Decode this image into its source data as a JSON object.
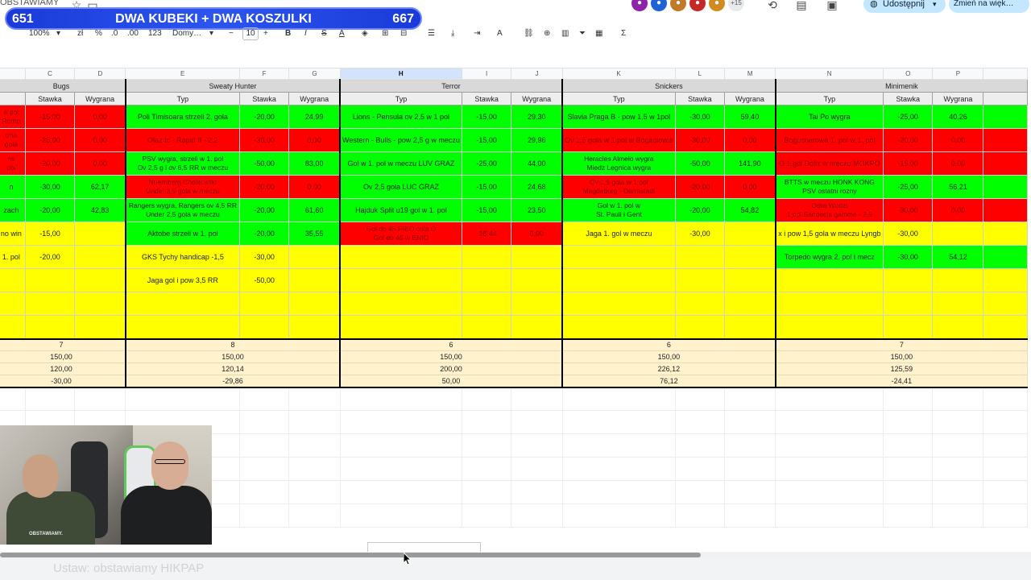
{
  "doc_title": "OBSTAWIAMY",
  "promo": {
    "left_count": "651",
    "title": "DWA KUBEKI + DWA KOSZULKI",
    "right_count": "667"
  },
  "top_right": {
    "extra_users": "+15",
    "share_label": "Udostępnij",
    "change_label": "Zmień na więk…"
  },
  "toolbar": {
    "zoom": "100%",
    "currency": "zł",
    "percent": "%",
    "decrease_decimal": ".0",
    "increase_decimal": ".00",
    "number_format": "123",
    "font": "Domy…",
    "font_size": "10",
    "bold": "B",
    "italic": "I",
    "strike": "S",
    "text_color": "A",
    "sum": "Σ"
  },
  "columns": {
    "c": "C",
    "d": "D",
    "e": "E",
    "f": "F",
    "g": "G",
    "h": "H",
    "i": "I",
    "j": "J",
    "k": "K",
    "l": "L",
    "m": "M",
    "n": "N",
    "o": "O",
    "p": "P"
  },
  "groups": {
    "bugs": "Bugs",
    "sweaty": "Sweaty Hunter",
    "terror": "Terror",
    "snickers": "Snickers",
    "minimenik": "Minimenik"
  },
  "sub": {
    "typ": "Typ",
    "stawka": "Stawka",
    "wygrana": "Wygrana"
  },
  "rows": [
    {
      "b": "a pol\nRomo",
      "c": "-15,00",
      "d": "0,00",
      "e": "Poli Timisoara strzeli 2. gola",
      "f": "-20,00",
      "g": "24,99",
      "h": "Lions - Pensula ov 2,5 w 1 pol",
      "i": "-15,00",
      "j": "29,30",
      "k": "Slavia Praga B - pow 1,5 w 1pol",
      "l": "-30,00",
      "m": "59,40",
      "n": "Tai Po wygra",
      "o": "-25,00",
      "p": "40,26"
    },
    {
      "b": "ona\ngola",
      "c": "-25,00",
      "d": "0,00",
      "e": "Olaz fc - Rapid II - 2:2",
      "f": "-30,00",
      "g": "0,00",
      "h": "Western - Bulls - pow 2,5 g w meczu",
      "i": "-15,00",
      "j": "29,96",
      "k": "Ov 1,5 gola w 1 pol w Bogaciowie",
      "l": "-30,00",
      "m": "0,00",
      "n": "Bogucharowa 1. pol w 1. pol",
      "o": "-20,00",
      "p": "0,00"
    },
    {
      "b": "ns\npol",
      "c": "-20,00",
      "d": "0,00",
      "e": "PSV wygra, strzeli w 1. pol\nOv 2,5 g i ov 6,5 RR w meczu",
      "f": "-50,00",
      "g": "83,00",
      "h": "Gol w 1. pol w meczu LUV GRAZ",
      "i": "-25,00",
      "j": "44,00",
      "k": "Heracles Almelo wygra\nMiedz Legnica wygra",
      "l": "-50,00",
      "m": "141,90",
      "n": "O 1 gol Doliz w meczu MOKPO",
      "o": "-15,00",
      "p": "0,00"
    },
    {
      "b": "n",
      "c": "-30,00",
      "d": "62,17",
      "e": "Nuernberg Cholet stikt\nUnder 3,5 gola w meczu",
      "f": "-20,00",
      "g": "0,00",
      "h": "Ov 2,5 gola LUC GRAZ",
      "i": "-15,00",
      "j": "24,68",
      "k": "Ov 1,5 gola w 1 pol\nMagdeburg - Darmstadt",
      "l": "-20,00",
      "m": "0,00",
      "n": "BTTS w meczu HONK KONG\nPSV ostatni rozny",
      "o": "-25,00",
      "p": "56,21"
    },
    {
      "b": "zach",
      "c": "-20,00",
      "d": "42,83",
      "e": "Rangers wygra, Rangers ov 4,5 RR\nUnder 2,5 gola w meczu",
      "f": "-20,00",
      "g": "61,60",
      "h": "Hajduk Split u19 gol w 1. pol",
      "i": "-15,00",
      "j": "23,50",
      "k": "Gol w 1. pol w\nSt. Pauli i Gent",
      "l": "-20,00",
      "m": "54,82",
      "n": "Odra Wodzi\n1 pol Sandecja gamme - 2,5",
      "o": "-30,00",
      "p": "0,00"
    },
    {
      "b": "no win",
      "c": "-15,00",
      "d": "",
      "e": "Aktobe strzeli w 1. pol",
      "f": "-20,00",
      "g": "35,55",
      "h": "Gol do 45 FRIO cola O\nGol do 45 w ENIO",
      "i": "-18,44",
      "j": "0,00",
      "k": "Jaga 1. gol w meczu",
      "l": "-30,00",
      "m": "",
      "n": "x i pow 1,5 gola w meczu Lyngb",
      "o": "-30,00",
      "p": ""
    },
    {
      "b": "1. pol",
      "c": "-20,00",
      "d": "",
      "e": "GKS Tychy handicap -1,5",
      "f": "-30,00",
      "g": "",
      "h": "",
      "i": "",
      "j": "",
      "k": "",
      "l": "",
      "m": "",
      "n": "Torpedo wygra 2. pol i mecz",
      "o": "-30,00",
      "p": "54,12"
    },
    {
      "b": "",
      "c": "",
      "d": "",
      "e": "Jaga gol i pow 3,5 RR",
      "f": "-50,00",
      "g": "",
      "h": "",
      "i": "",
      "j": "",
      "k": "",
      "l": "",
      "m": "",
      "n": "",
      "o": "",
      "p": ""
    },
    {
      "b": "",
      "c": "",
      "d": "",
      "e": "",
      "f": "",
      "g": "",
      "h": "",
      "i": "",
      "j": "",
      "k": "",
      "l": "",
      "m": "",
      "n": "",
      "o": "",
      "p": ""
    },
    {
      "b": "",
      "c": "",
      "d": "",
      "e": "",
      "f": "",
      "g": "",
      "h": "",
      "i": "",
      "j": "",
      "k": "",
      "l": "",
      "m": "",
      "n": "",
      "o": "",
      "p": ""
    }
  ],
  "summary": {
    "count": {
      "bugs": "7",
      "sweaty": "8",
      "terror": "6",
      "snickers": "6",
      "minimenik": "7"
    },
    "stake": {
      "bugs": "150,00",
      "sweaty": "150,00",
      "terror": "150,00",
      "snickers": "150,00",
      "minimenik": "150,00"
    },
    "won": {
      "bugs": "120,00",
      "sweaty": "120,14",
      "terror": "200,00",
      "snickers": "226,12",
      "minimenik": "125,59"
    },
    "net": {
      "bugs": "-30,00",
      "sweaty": "-29,86",
      "terror": "50,00",
      "snickers": "76,12",
      "minimenik": "-24,41"
    }
  },
  "webcam": {
    "shirt_text": "OBSTAWIAMY."
  },
  "bottom_text": "Ustaw: obstawiamy HIKPAP",
  "colors": {
    "win": "#00ff00",
    "loss": "#ff0000",
    "pending": "#ffff00",
    "summary": "#fff2cc",
    "promo": "#2c55f0"
  }
}
